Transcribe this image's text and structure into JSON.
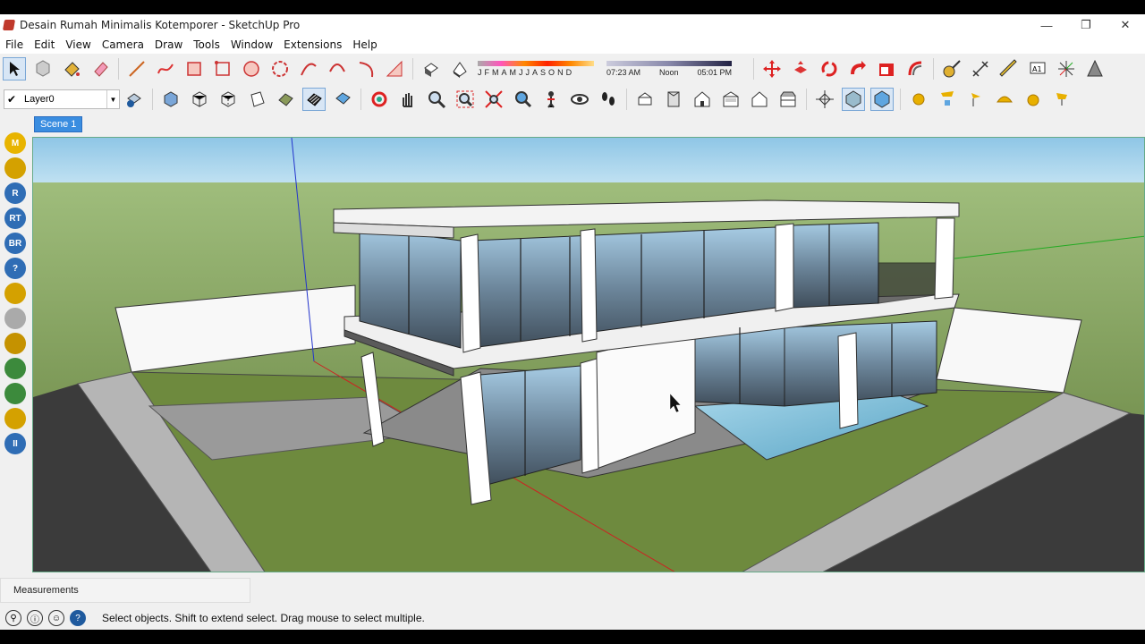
{
  "window": {
    "title": "Desain Rumah Minimalis Kotemporer - SketchUp Pro",
    "minimize": "—",
    "maximize": "❐",
    "close": "✕"
  },
  "menu": [
    "File",
    "Edit",
    "View",
    "Camera",
    "Draw",
    "Tools",
    "Window",
    "Extensions",
    "Help"
  ],
  "shadow": {
    "months": [
      "J",
      "F",
      "M",
      "A",
      "M",
      "J",
      "J",
      "A",
      "S",
      "O",
      "N",
      "D"
    ],
    "time_start": "07:23 AM",
    "time_mid": "Noon",
    "time_end": "05:01 PM"
  },
  "layer": {
    "checked": "✔",
    "name": "Layer0"
  },
  "scene": {
    "tab": "Scene 1"
  },
  "left_tools": [
    {
      "icon": "m-plugin-icon",
      "label": "M",
      "color": "#e8b400"
    },
    {
      "icon": "tag-plugin-icon",
      "label": "",
      "color": "#d4a100"
    },
    {
      "icon": "r-plugin-icon",
      "label": "R",
      "color": "#2f6db5"
    },
    {
      "icon": "rt-plugin-icon",
      "label": "RT",
      "color": "#2f6db5"
    },
    {
      "icon": "br-plugin-icon",
      "label": "BR",
      "color": "#2f6db5"
    },
    {
      "icon": "help-plugin-icon",
      "label": "?",
      "color": "#2f6db5"
    },
    {
      "icon": "tag2-plugin-icon",
      "label": "",
      "color": "#d4a100"
    },
    {
      "icon": "sphere-plugin-icon",
      "label": "",
      "color": "#aaaaaa"
    },
    {
      "icon": "wave-plugin-icon",
      "label": "",
      "color": "#c59200"
    },
    {
      "icon": "tree-plugin-icon",
      "label": "",
      "color": "#3c8a3c"
    },
    {
      "icon": "tree2-plugin-icon",
      "label": "",
      "color": "#3c8a3c"
    },
    {
      "icon": "target-plugin-icon",
      "label": "",
      "color": "#d4a100"
    },
    {
      "icon": "pause-plugin-icon",
      "label": "II",
      "color": "#2f6db5"
    }
  ],
  "measurements": {
    "label": "Measurements"
  },
  "status": {
    "text": "Select objects. Shift to extend select. Drag mouse to select multiple."
  }
}
